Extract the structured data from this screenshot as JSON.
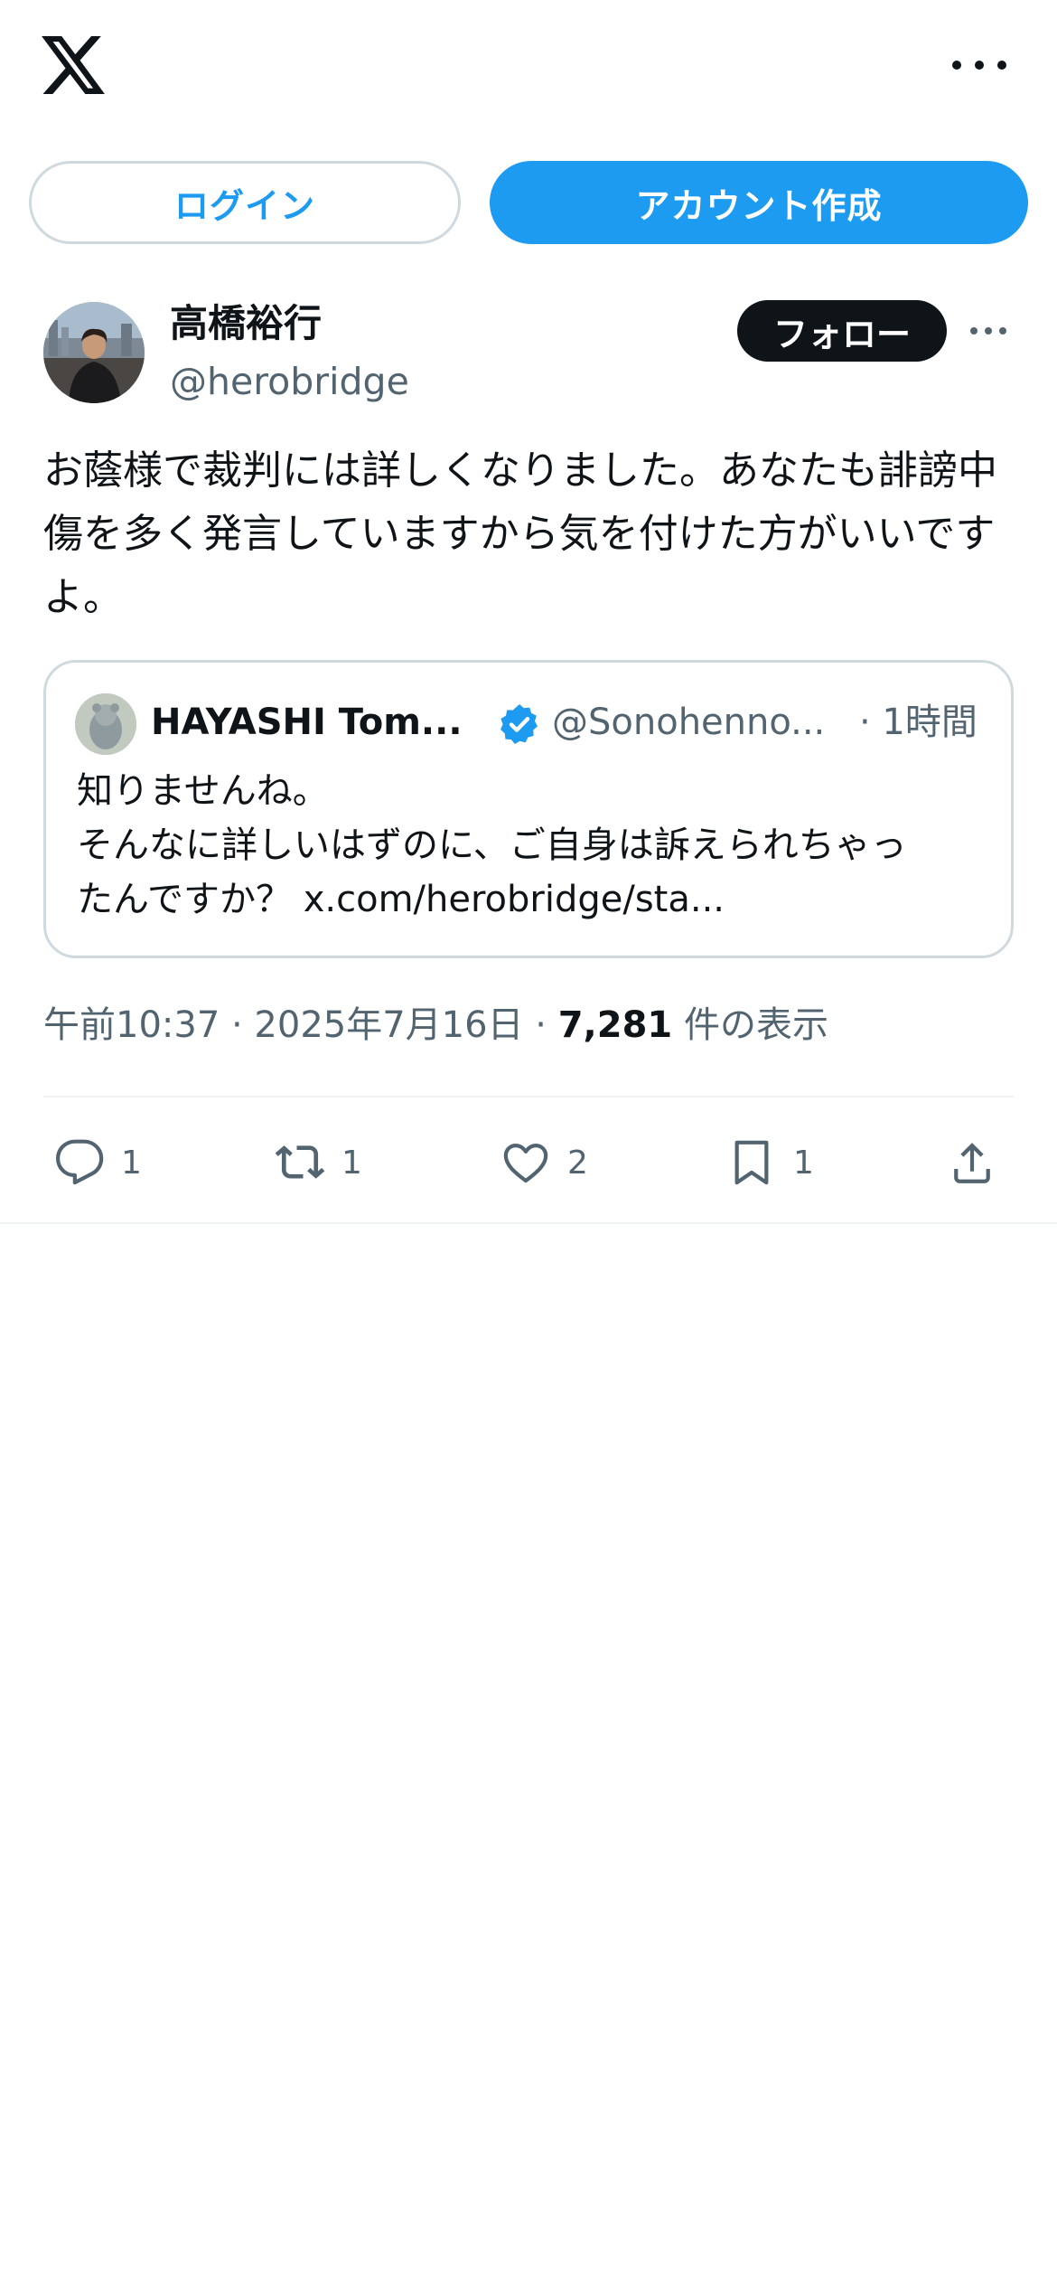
{
  "app": {
    "logo_icon": "x-logo-icon",
    "more_icon": "more-horizontal-icon"
  },
  "auth": {
    "login_label": "ログイン",
    "signup_label": "アカウント作成"
  },
  "tweet": {
    "author_name": "高橋裕行",
    "author_handle": "@herobridge",
    "follow_label": "フォロー",
    "text": "お蔭様で裁判には詳しくなりました。あなたも誹謗中傷を多く発言していますから気を付けた方がいいですよ。",
    "timestamp": "午前10:37 · 2025年7月16日 · ",
    "views_count": "7,281",
    "views_label": " 件の表示"
  },
  "quote": {
    "author_name": "HAYASHI Tom...",
    "author_handle": "@Sonohenno...",
    "time": "· 1時間",
    "line1": "知りませんね。",
    "line2": "そんなに詳しいはずのに、ご自身は訴えられちゃっ",
    "line3": "たんですか？ x.com/herobridge/sta..."
  },
  "actions": {
    "reply_count": "1",
    "retweet_count": "1",
    "like_count": "2",
    "bookmark_count": "1"
  },
  "colors": {
    "accent": "#1d9bf0",
    "text_primary": "#0f1419",
    "text_secondary": "#536471",
    "border": "#cfd9de"
  }
}
